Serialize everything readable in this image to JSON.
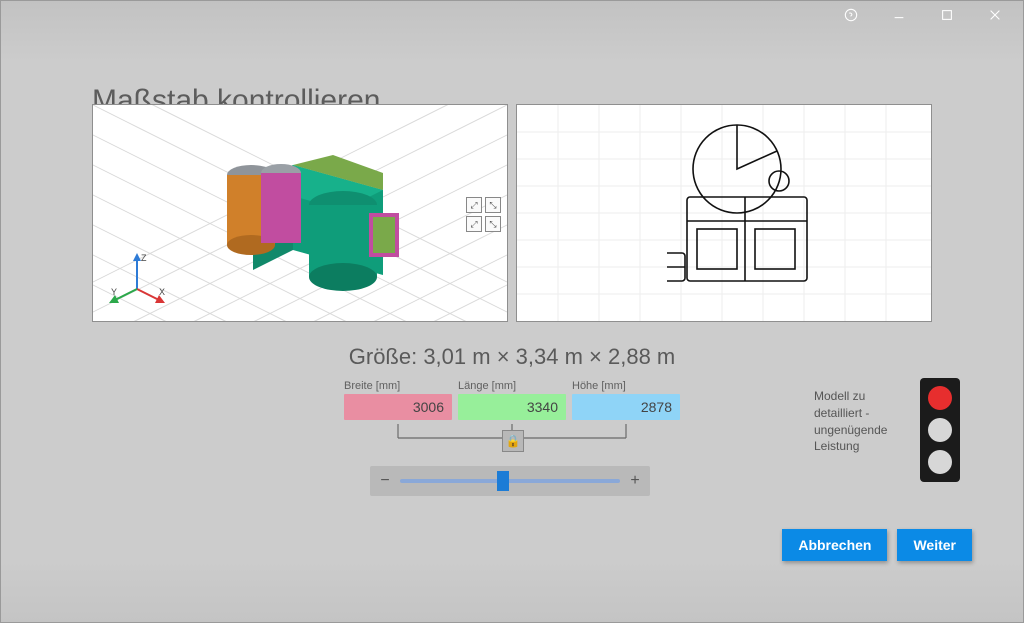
{
  "titlebar": {
    "help_icon": "help",
    "minimize_icon": "minimize",
    "maximize_icon": "maximize",
    "close_icon": "close"
  },
  "page_title": "Maßstab kontrollieren",
  "size_line": "Größe: 3,01 m × 3,34 m × 2,88 m",
  "dimensions": {
    "breite": {
      "label": "Breite [mm]",
      "value": "3006"
    },
    "laenge": {
      "label": "Länge [mm]",
      "value": "3340"
    },
    "hoehe": {
      "label": "Höhe [mm]",
      "value": "2878"
    }
  },
  "lock_icon": "🔒",
  "slider": {
    "minus": "−",
    "plus": "+"
  },
  "status_text": "Modell zu detailliert - ungenügende Leistung",
  "traffic_state": "red",
  "axes": {
    "x": "X",
    "y": "Y",
    "z": "Z"
  },
  "buttons": {
    "cancel": "Abbrechen",
    "next": "Weiter"
  },
  "colors": {
    "accent": "#0b8ae6",
    "breite_bg": "#e98ea2",
    "laenge_bg": "#97ef9a",
    "hoehe_bg": "#8fd4f7"
  }
}
